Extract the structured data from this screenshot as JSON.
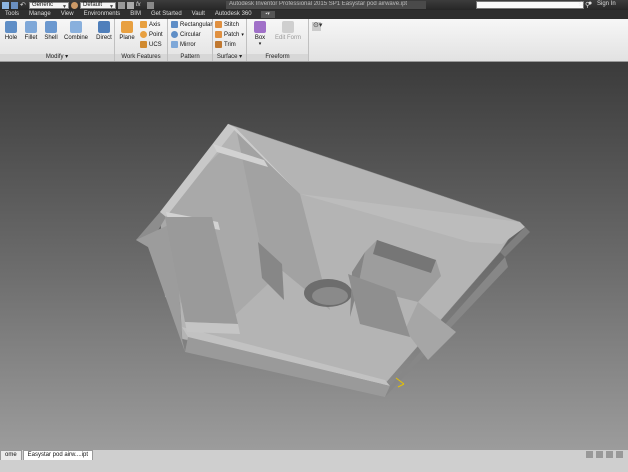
{
  "titlebar": {
    "material": "Generic",
    "appearance": "Default",
    "app_title": "Autodesk Inventor Professional 2015 SP1  Easystar pod airwave.ipt",
    "sign_in": "Sign In",
    "search_placeholder": ""
  },
  "menubar": {
    "tabs": [
      "Tools",
      "Manage",
      "View",
      "Environments",
      "BIM",
      "Get Started",
      "Vault",
      "Autodesk 360"
    ],
    "active_tab_index": -1
  },
  "ribbon": {
    "modify": {
      "label": "Modify",
      "buttons": [
        "Hole",
        "Fillet",
        "Shell",
        "Combine",
        "Direct"
      ]
    },
    "work_features": {
      "label": "Work Features",
      "plane": "Plane",
      "axis": "Axis",
      "point": "Point",
      "ucs": "UCS"
    },
    "pattern": {
      "label": "Pattern",
      "rectangular": "Rectangular",
      "circular": "Circular",
      "mirror": "Mirror"
    },
    "surface": {
      "label": "Surface",
      "stitch": "Stitch",
      "patch": "Patch",
      "trim": "Trim"
    },
    "freeform": {
      "label": "Freeform",
      "box": "Box",
      "edit_form": "Edit Form"
    }
  },
  "statusbar": {
    "tabs": [
      "ome",
      "Easystar pod airw....ipt"
    ],
    "active_tab_index": 1
  },
  "colors": {
    "titlebar": "#2e2e2e",
    "ribbon": "#ececec",
    "viewport_top": "#3b3b3b",
    "viewport_bottom": "#9c9c9c",
    "model_face": "#b8b8b8",
    "model_side": "#8e8e8e",
    "model_dark": "#6a6a6a",
    "freeform_accent": "#a070c8"
  }
}
